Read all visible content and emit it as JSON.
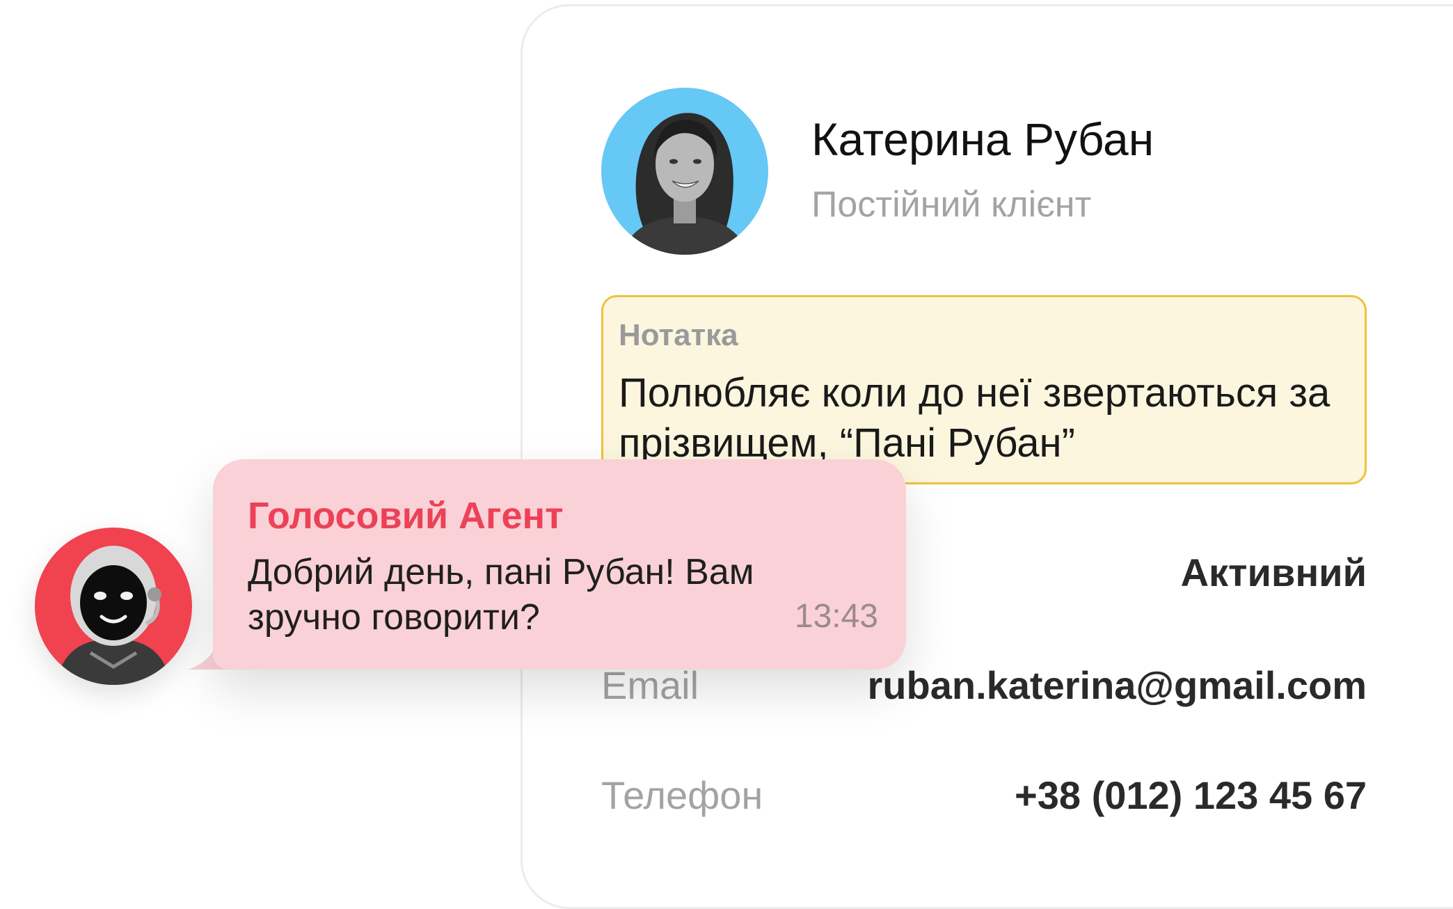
{
  "contact": {
    "name": "Катерина Рубан",
    "status": "Постійний клієнт",
    "avatar_bg": "#66c8f5"
  },
  "note": {
    "title": "Нотатка",
    "text": "Полюбляє коли до неї звертаються за прізвищем, “Пані Рубан”"
  },
  "fields": {
    "status_value": "Активний",
    "email_label": "Email",
    "email_value": "ruban.katerina@gmail.com",
    "phone_label": "Телефон",
    "phone_value": "+38 (012) 123 45 67"
  },
  "chat": {
    "sender": "Голосовий Агент",
    "message": "Добрий день, пані Рубан! Вам зручно говорити?",
    "time": "13:43",
    "bubble_color": "#f9d1d6",
    "sender_color": "#ec4257",
    "agent_avatar_bg": "#f0424f"
  }
}
